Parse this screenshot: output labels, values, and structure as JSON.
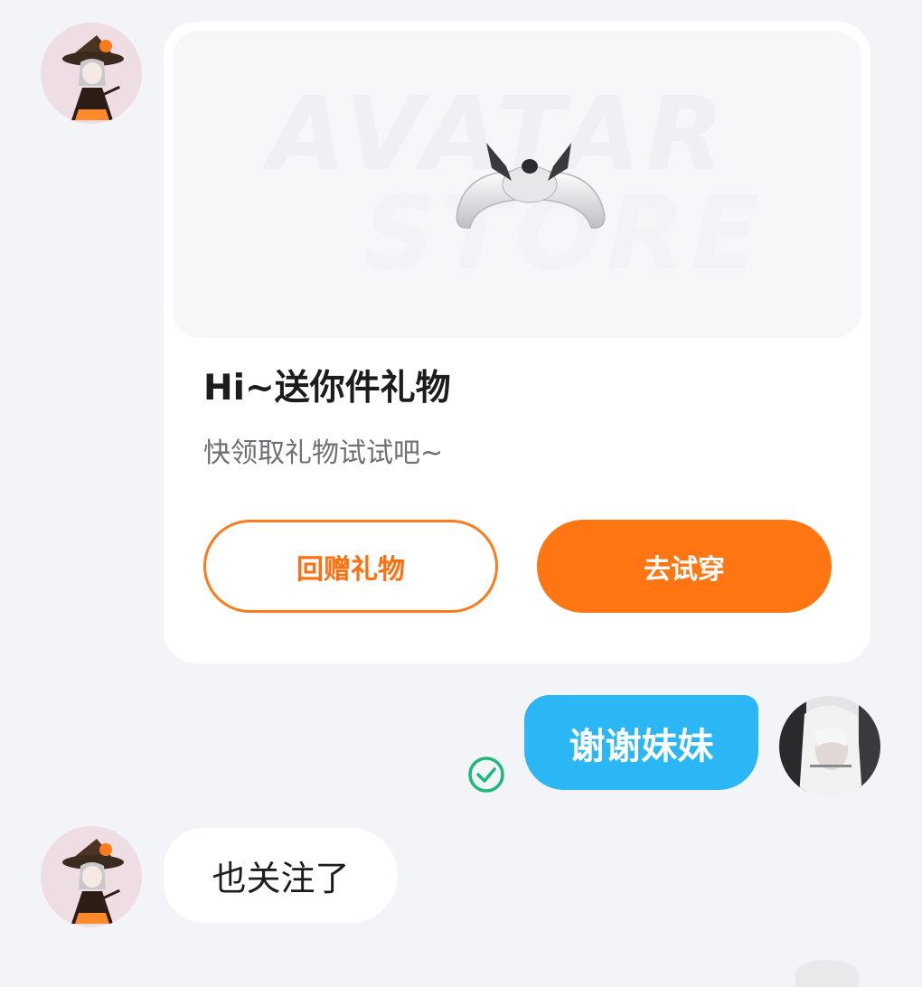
{
  "gift_card": {
    "banner_watermark_line1": "AVATAR",
    "banner_watermark_line2": "STORE",
    "title": "Hi~送你件礼物",
    "subtitle": "快领取礼物试试吧~",
    "return_gift_label": "回赠礼物",
    "try_on_label": "去试穿"
  },
  "messages": {
    "outgoing_text": "谢谢妹妹",
    "incoming_text": "也关注了"
  },
  "icons": {
    "read_receipt": "check-circle-icon",
    "gift_item": "bow-headband-icon"
  },
  "colors": {
    "accent_orange": "#ff7612",
    "outgoing_bubble": "#2bb6f6",
    "read_check": "#1db87a",
    "page_background": "#f3f4f8"
  }
}
